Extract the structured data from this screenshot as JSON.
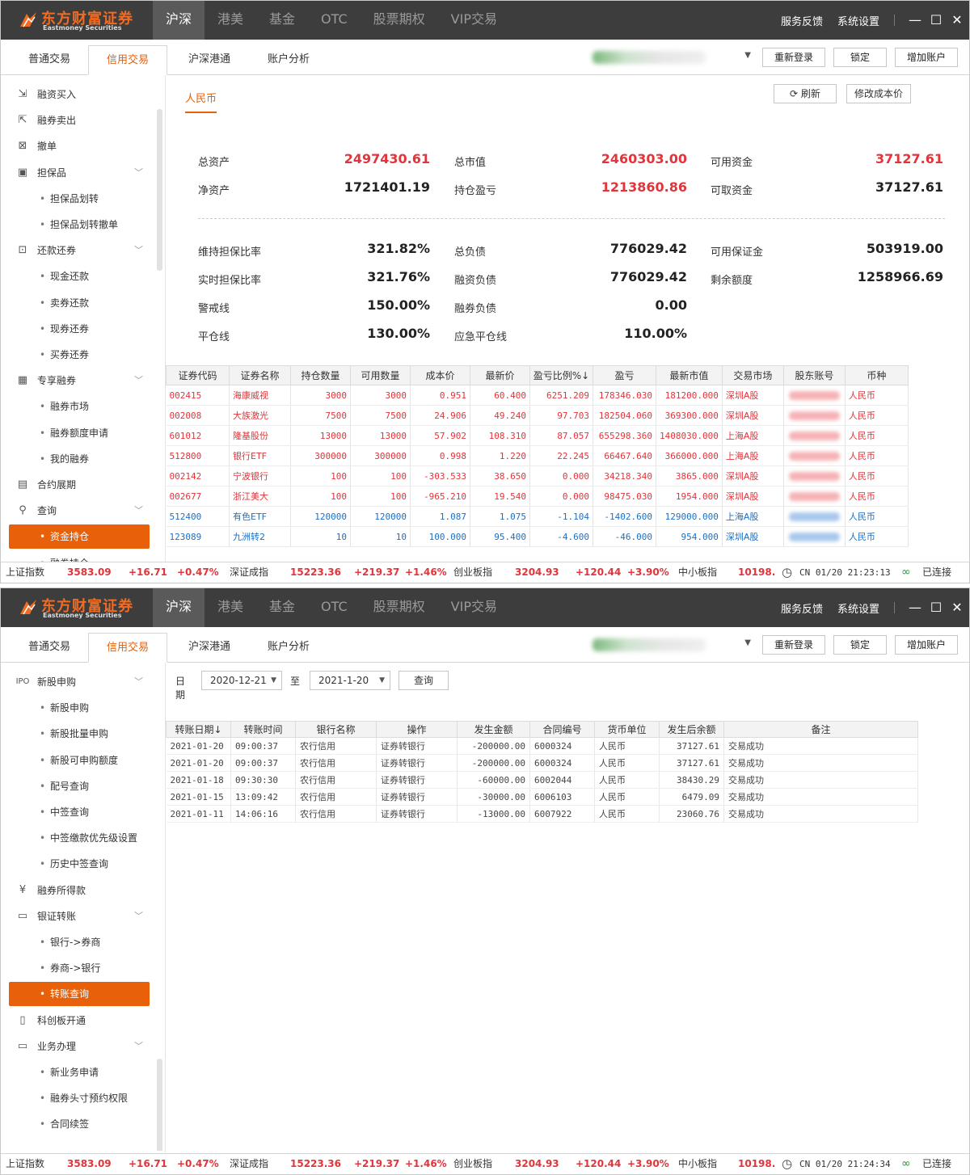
{
  "app": {
    "logo_cn": "东方财富证券",
    "logo_en": "Eastmoney Securities",
    "main_tabs": [
      "沪深",
      "港美",
      "基金",
      "OTC",
      "股票期权",
      "VIP交易"
    ],
    "title_links": [
      "服务反馈",
      "系统设置"
    ],
    "window_buttons": [
      "minimize-icon",
      "maximize-icon",
      "close-icon"
    ],
    "sub_tabs": [
      "普通交易",
      "信用交易",
      "沪深港通",
      "账户分析"
    ],
    "sub_buttons": [
      "重新登录",
      "锁定",
      "增加账户"
    ],
    "accent": "#e8600a",
    "up_color": "#e2343a",
    "down_color": "#1c6fc4"
  },
  "window1": {
    "sidebar": [
      {
        "label": "融资买入",
        "icon": "financing-buy-icon",
        "glyph": "⇲"
      },
      {
        "label": "融券卖出",
        "icon": "securities-sell-icon",
        "glyph": "⇱"
      },
      {
        "label": "撤单",
        "icon": "cancel-order-icon",
        "glyph": "⊠"
      },
      {
        "label": "担保品",
        "icon": "collateral-icon",
        "glyph": "▣",
        "expand": true
      },
      {
        "label": "担保品划转",
        "sub": true
      },
      {
        "label": "担保品划转撤单",
        "sub": true
      },
      {
        "label": "还款还券",
        "icon": "repay-icon",
        "glyph": "⊡",
        "expand": true
      },
      {
        "label": "现金还款",
        "sub": true
      },
      {
        "label": "卖券还款",
        "sub": true
      },
      {
        "label": "现券还券",
        "sub": true
      },
      {
        "label": "买券还券",
        "sub": true
      },
      {
        "label": "专享融券",
        "icon": "exclusive-icon",
        "glyph": "▦",
        "expand": true
      },
      {
        "label": "融券市场",
        "sub": true
      },
      {
        "label": "融券额度申请",
        "sub": true
      },
      {
        "label": "我的融券",
        "sub": true
      },
      {
        "label": "合约展期",
        "icon": "contract-icon",
        "glyph": "▤"
      },
      {
        "label": "查询",
        "icon": "search-icon",
        "glyph": "⚲",
        "expand": true
      },
      {
        "label": "资金持仓",
        "sub": true,
        "active": true
      },
      {
        "label": "融券持仓",
        "sub": true
      }
    ],
    "currency_tab": "人民币",
    "buttons": {
      "refresh": "刷新",
      "edit_cost": "修改成本价"
    },
    "summary": [
      {
        "label": "总资产",
        "value": "2497430.61",
        "color": "red"
      },
      {
        "label": "总市值",
        "value": "2460303.00",
        "color": "red"
      },
      {
        "label": "可用资金",
        "value": "37127.61",
        "color": "red"
      },
      {
        "label": "净资产",
        "value": "1721401.19",
        "color": "dark"
      },
      {
        "label": "持仓盈亏",
        "value": "1213860.86",
        "color": "red"
      },
      {
        "label": "可取资金",
        "value": "37127.61",
        "color": "dark"
      },
      {
        "label": "维持担保比率",
        "value": "321.82%",
        "color": "dark"
      },
      {
        "label": "总负债",
        "value": "776029.42",
        "color": "dark"
      },
      {
        "label": "可用保证金",
        "value": "503919.00",
        "color": "dark"
      },
      {
        "label": "实时担保比率",
        "value": "321.76%",
        "color": "dark"
      },
      {
        "label": "融资负债",
        "value": "776029.42",
        "color": "dark"
      },
      {
        "label": "剩余额度",
        "value": "1258966.69",
        "color": "dark"
      },
      {
        "label": "警戒线",
        "value": "150.00%",
        "color": "dark"
      },
      {
        "label": "融券负债",
        "value": "0.00",
        "color": "dark"
      },
      {
        "label": "平仓线",
        "value": "130.00%",
        "color": "dark"
      },
      {
        "label": "应急平仓线",
        "value": "110.00%",
        "color": "dark"
      }
    ],
    "table_headers": [
      "证券代码",
      "证券名称",
      "持仓数量",
      "可用数量",
      "成本价",
      "最新价",
      "盈亏比例%↓",
      "盈亏",
      "最新市值",
      "交易市场",
      "股东账号",
      "币种"
    ],
    "rows": [
      {
        "c": "r",
        "cells": [
          "002415",
          "海康威视",
          "3000",
          "3000",
          "0.951",
          "60.400",
          "6251.209",
          "178346.030",
          "181200.000",
          "深圳A股",
          "",
          "人民币"
        ]
      },
      {
        "c": "r",
        "cells": [
          "002008",
          "大族激光",
          "7500",
          "7500",
          "24.906",
          "49.240",
          "97.703",
          "182504.060",
          "369300.000",
          "深圳A股",
          "",
          "人民币"
        ]
      },
      {
        "c": "r",
        "cells": [
          "601012",
          "隆基股份",
          "13000",
          "13000",
          "57.902",
          "108.310",
          "87.057",
          "655298.360",
          "1408030.000",
          "上海A股",
          "",
          "人民币"
        ]
      },
      {
        "c": "r",
        "cells": [
          "512800",
          "银行ETF",
          "300000",
          "300000",
          "0.998",
          "1.220",
          "22.245",
          "66467.640",
          "366000.000",
          "上海A股",
          "",
          "人民币"
        ]
      },
      {
        "c": "r",
        "cells": [
          "002142",
          "宁波银行",
          "100",
          "100",
          "-303.533",
          "38.650",
          "0.000",
          "34218.340",
          "3865.000",
          "深圳A股",
          "",
          "人民币"
        ]
      },
      {
        "c": "r",
        "cells": [
          "002677",
          "浙江美大",
          "100",
          "100",
          "-965.210",
          "19.540",
          "0.000",
          "98475.030",
          "1954.000",
          "深圳A股",
          "",
          "人民币"
        ]
      },
      {
        "c": "b",
        "cells": [
          "512400",
          "有色ETF",
          "120000",
          "120000",
          "1.087",
          "1.075",
          "-1.104",
          "-1402.600",
          "129000.000",
          "上海A股",
          "",
          "人民币"
        ]
      },
      {
        "c": "b",
        "cells": [
          "123089",
          "九洲转2",
          "10",
          "10",
          "100.000",
          "95.400",
          "-4.600",
          "-46.000",
          "954.000",
          "深圳A股",
          "",
          "人民币"
        ]
      }
    ],
    "clock": "CN 01/20 21:23:13"
  },
  "window2": {
    "sidebar": [
      {
        "label": "新股申购",
        "icon": "ipo-icon",
        "glyph": "IPO",
        "expand": true
      },
      {
        "label": "新股申购",
        "sub": true
      },
      {
        "label": "新股批量申购",
        "sub": true
      },
      {
        "label": "新股可申购额度",
        "sub": true
      },
      {
        "label": "配号查询",
        "sub": true
      },
      {
        "label": "中签查询",
        "sub": true
      },
      {
        "label": "中签缴款优先级设置",
        "sub": true
      },
      {
        "label": "历史中签查询",
        "sub": true
      },
      {
        "label": "融券所得款",
        "icon": "yen-icon",
        "glyph": "¥"
      },
      {
        "label": "银证转账",
        "icon": "bank-transfer-icon",
        "glyph": "▭",
        "expand": true
      },
      {
        "label": "银行->券商",
        "sub": true
      },
      {
        "label": "券商->银行",
        "sub": true
      },
      {
        "label": "转账查询",
        "sub": true,
        "active": true
      },
      {
        "label": "科创板开通",
        "icon": "book-icon",
        "glyph": "▯"
      },
      {
        "label": "业务办理",
        "icon": "briefcase-icon",
        "glyph": "▭",
        "expand": true
      },
      {
        "label": "新业务申请",
        "sub": true
      },
      {
        "label": "融券头寸预约权限",
        "sub": true
      },
      {
        "label": "合同续签",
        "sub": true
      }
    ],
    "query": {
      "date_label": "日期",
      "from": "2020-12-21",
      "to_label": "至",
      "to": "2021-1-20",
      "button": "查询"
    },
    "table_headers": [
      "转账日期↓",
      "转账时间",
      "银行名称",
      "操作",
      "发生金额",
      "合同编号",
      "货币单位",
      "发生后余额",
      "备注"
    ],
    "rows": [
      [
        "2021-01-20",
        "09:00:37",
        "农行信用",
        "证券转银行",
        "-200000.00",
        "6000324",
        "人民币",
        "37127.61",
        "交易成功"
      ],
      [
        "2021-01-20",
        "09:00:37",
        "农行信用",
        "证券转银行",
        "-200000.00",
        "6000324",
        "人民币",
        "37127.61",
        "交易成功"
      ],
      [
        "2021-01-18",
        "09:30:30",
        "农行信用",
        "证券转银行",
        "-60000.00",
        "6002044",
        "人民币",
        "38430.29",
        "交易成功"
      ],
      [
        "2021-01-15",
        "13:09:42",
        "农行信用",
        "证券转银行",
        "-30000.00",
        "6006103",
        "人民币",
        "6479.09",
        "交易成功"
      ],
      [
        "2021-01-11",
        "14:06:16",
        "农行信用",
        "证券转银行",
        "-13000.00",
        "6007922",
        "人民币",
        "23060.76",
        "交易成功"
      ]
    ],
    "clock": "CN 01/20 21:24:34"
  },
  "ticker": [
    {
      "name": "上证指数",
      "price": "3583.09",
      "change": "+16.71",
      "pct": "+0.47%"
    },
    {
      "name": "深证成指",
      "price": "15223.36",
      "change": "+219.37",
      "pct": "+1.46%"
    },
    {
      "name": "创业板指",
      "price": "3204.93",
      "change": "+120.44",
      "pct": "+3.90%"
    },
    {
      "name": "中小板指",
      "price": "10198.",
      "change": "",
      "pct": ""
    }
  ],
  "connection": "已连接"
}
